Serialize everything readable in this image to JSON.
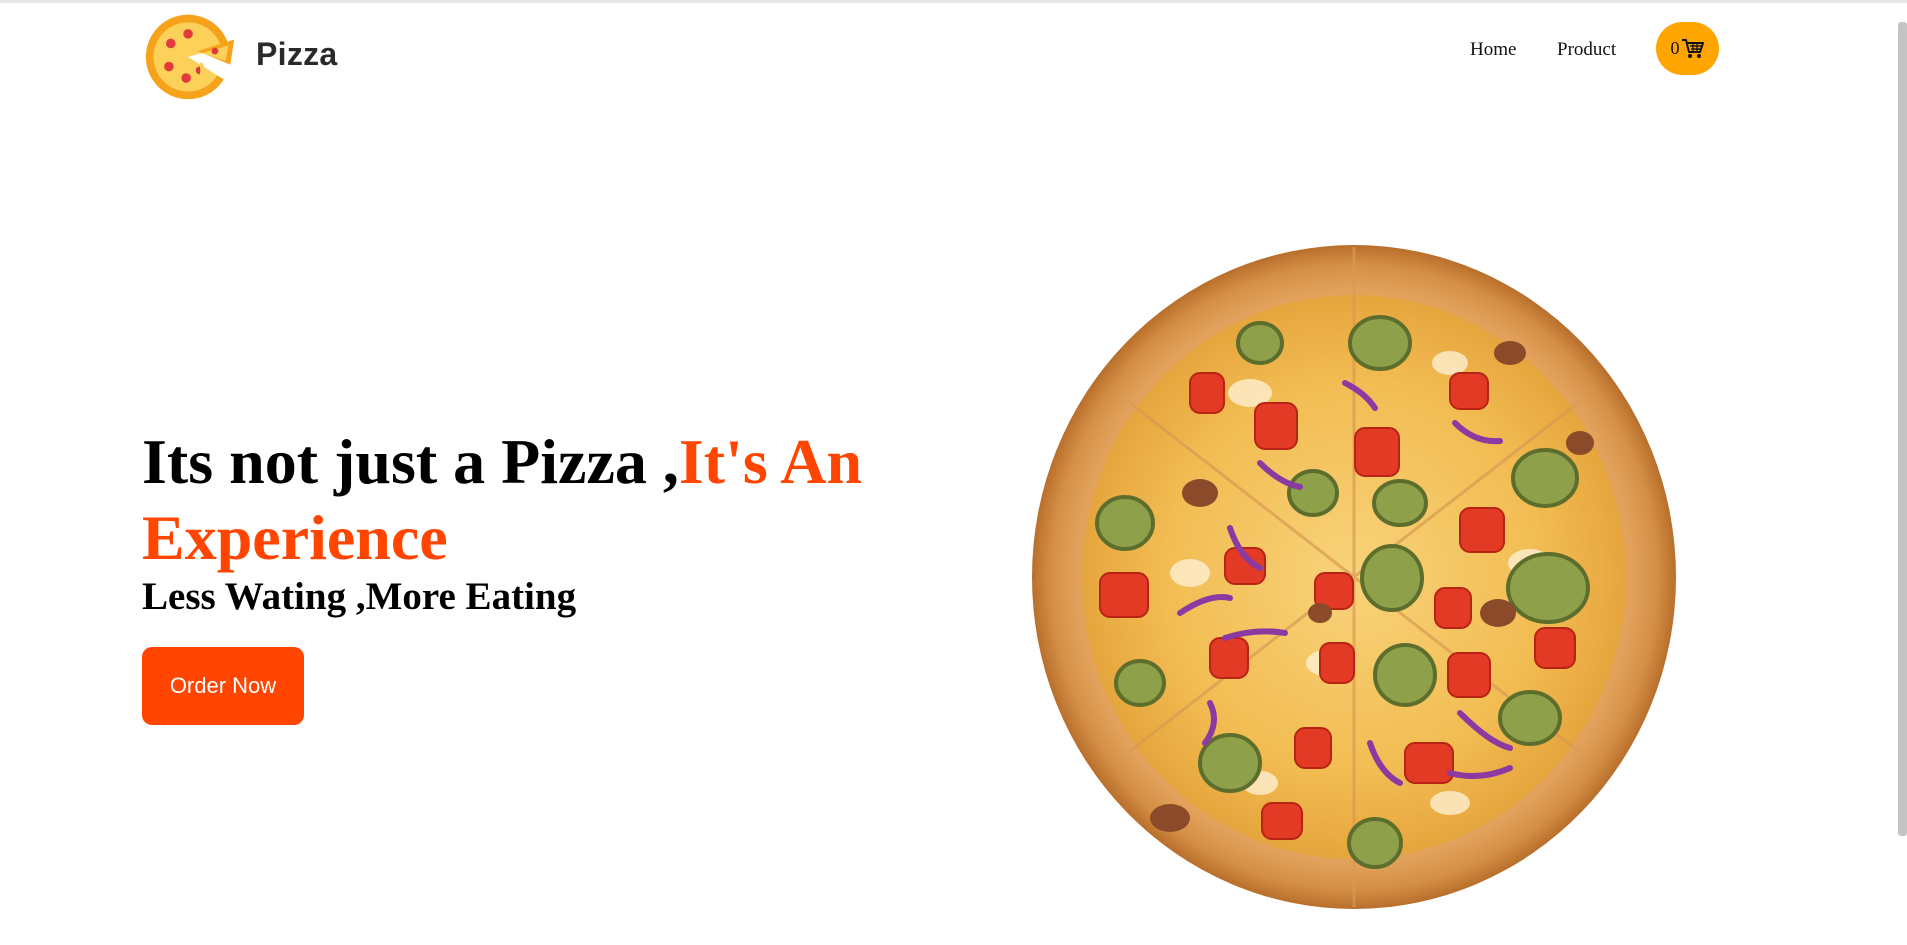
{
  "header": {
    "brand": "Pizza",
    "nav": [
      "Home",
      "Product"
    ],
    "cart_count": "0"
  },
  "hero": {
    "headline_main": "Its not just a Pizza ,",
    "headline_accent": "It's An Experience",
    "subline": "Less Wating ,More Eating",
    "cta_label": "Order Now"
  },
  "icons": {
    "logo": "pizza-slice-logo-icon",
    "cart": "shopping-cart-icon",
    "hero_image": "pizza-image"
  },
  "colors": {
    "accent": "#ff4500",
    "cart_bg": "#ffa500",
    "text": "#000000"
  }
}
